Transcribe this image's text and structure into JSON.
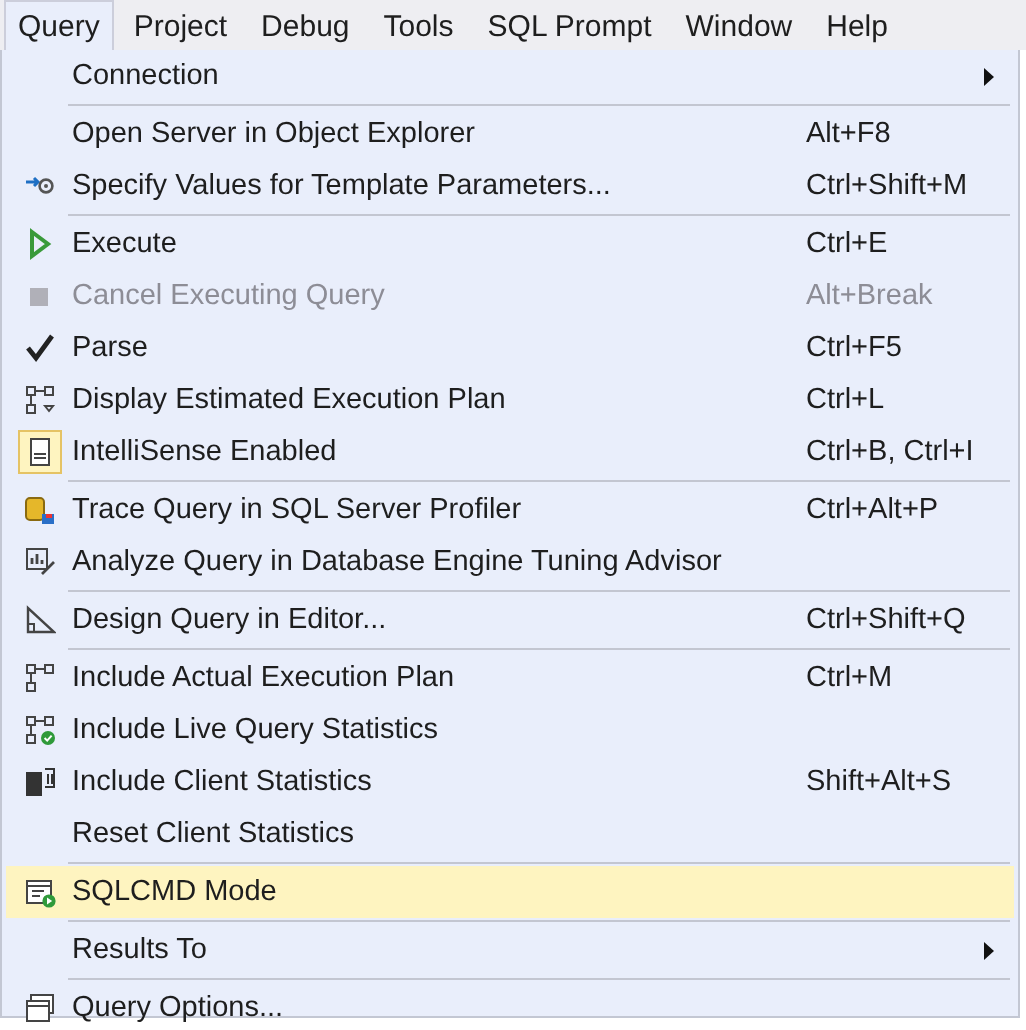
{
  "menubar": [
    {
      "label": "Query",
      "selected": true
    },
    {
      "label": "Project",
      "selected": false
    },
    {
      "label": "Debug",
      "selected": false
    },
    {
      "label": "Tools",
      "selected": false
    },
    {
      "label": "SQL Prompt",
      "selected": false
    },
    {
      "label": "Window",
      "selected": false
    },
    {
      "label": "Help",
      "selected": false
    }
  ],
  "menu": [
    {
      "kind": "item",
      "label": "Connection",
      "submenu": true,
      "disabled": false,
      "checked": false,
      "selected": false
    },
    {
      "kind": "separator"
    },
    {
      "kind": "item",
      "label": "Open Server in Object Explorer",
      "shortcut": "Alt+F8",
      "disabled": false,
      "checked": false,
      "selected": false
    },
    {
      "kind": "item",
      "label": "Specify Values for Template Parameters...",
      "shortcut": "Ctrl+Shift+M",
      "disabled": false,
      "checked": false,
      "selected": false
    },
    {
      "kind": "separator"
    },
    {
      "kind": "item",
      "label": "Execute",
      "shortcut": "Ctrl+E",
      "disabled": false,
      "checked": false,
      "selected": false
    },
    {
      "kind": "item",
      "label": "Cancel Executing Query",
      "shortcut": "Alt+Break",
      "disabled": true,
      "checked": false,
      "selected": false
    },
    {
      "kind": "item",
      "label": "Parse",
      "shortcut": "Ctrl+F5",
      "disabled": false,
      "checked": false,
      "selected": false
    },
    {
      "kind": "item",
      "label": "Display Estimated Execution Plan",
      "shortcut": "Ctrl+L",
      "disabled": false,
      "checked": false,
      "selected": false
    },
    {
      "kind": "item",
      "label": "IntelliSense Enabled",
      "shortcut": "Ctrl+B, Ctrl+I",
      "disabled": false,
      "checked": true,
      "selected": false
    },
    {
      "kind": "separator"
    },
    {
      "kind": "item",
      "label": "Trace Query in SQL Server Profiler",
      "shortcut": "Ctrl+Alt+P",
      "disabled": false,
      "checked": false,
      "selected": false
    },
    {
      "kind": "item",
      "label": "Analyze Query in Database Engine Tuning Advisor",
      "disabled": false,
      "checked": false,
      "selected": false
    },
    {
      "kind": "separator"
    },
    {
      "kind": "item",
      "label": "Design Query in Editor...",
      "shortcut": "Ctrl+Shift+Q",
      "disabled": false,
      "checked": false,
      "selected": false
    },
    {
      "kind": "separator"
    },
    {
      "kind": "item",
      "label": "Include Actual Execution Plan",
      "shortcut": "Ctrl+M",
      "disabled": false,
      "checked": false,
      "selected": false
    },
    {
      "kind": "item",
      "label": "Include Live Query Statistics",
      "disabled": false,
      "checked": false,
      "selected": false
    },
    {
      "kind": "item",
      "label": "Include Client Statistics",
      "shortcut": "Shift+Alt+S",
      "disabled": false,
      "checked": false,
      "selected": false
    },
    {
      "kind": "item",
      "label": "Reset Client Statistics",
      "disabled": false,
      "checked": false,
      "selected": false
    },
    {
      "kind": "separator"
    },
    {
      "kind": "item",
      "label": "SQLCMD Mode",
      "disabled": false,
      "checked": false,
      "selected": true
    },
    {
      "kind": "separator"
    },
    {
      "kind": "item",
      "label": "Results To",
      "submenu": true,
      "disabled": false,
      "checked": false,
      "selected": false
    },
    {
      "kind": "separator"
    },
    {
      "kind": "item",
      "label": "Query Options...",
      "disabled": false,
      "checked": false,
      "selected": false
    }
  ]
}
